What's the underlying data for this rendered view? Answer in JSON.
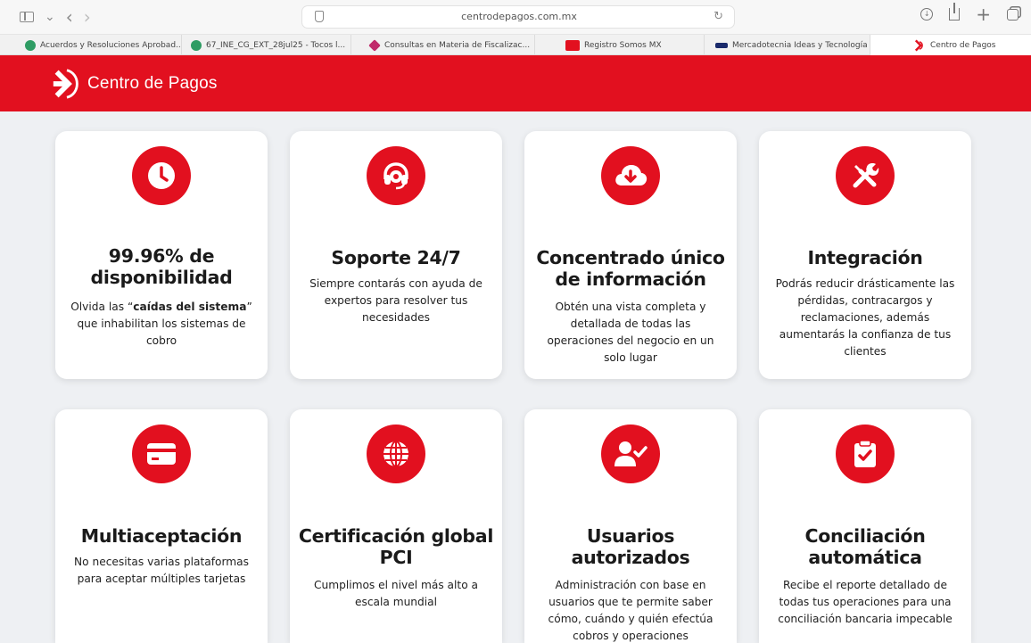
{
  "browser": {
    "url": "centrodepagos.com.mx",
    "back": "‹",
    "forward": "›",
    "new_tab": "+"
  },
  "bookmarks": [
    {
      "label": "Acuerdos y Resoluciones Aprobad...",
      "color": "#2e9c63"
    },
    {
      "label": "67_INE_CG_EXT_28jul25 - Tocos l...",
      "color": "#2e9c63"
    },
    {
      "label": "Consultas en Materia de Fiscalizac...",
      "color": "#c02a6b"
    },
    {
      "label": "Registro Somos MX",
      "color": "#e2101f"
    },
    {
      "label": "Mercadotecnia Ideas y Tecnología",
      "color": "#1a2a6b"
    },
    {
      "label": "Centro de Pagos",
      "color": "#e2101f"
    }
  ],
  "site": {
    "logo_text": "Centro de Pagos",
    "brand_color": "#e2101f"
  },
  "cards": [
    {
      "title": "99.96% de disponibilidad",
      "desc_pre": "Olvida las “",
      "desc_bold": "caídas del sistema",
      "desc_post": "” que inhabilitan los sistemas de cobro",
      "icon": "clock-icon"
    },
    {
      "title": "Soporte 24/7",
      "desc": "Siempre contarás con ayuda de expertos para resolver tus necesidades",
      "icon": "headset-icon"
    },
    {
      "title": "Concentrado único de información",
      "desc": "Obtén una vista completa y detallada de todas las operaciones del negocio en un solo lugar",
      "icon": "cloud-download-icon"
    },
    {
      "title": "Integración",
      "desc": "Podrás reducir drásticamente las pérdidas, contracargos y reclamaciones, además aumentarás la confianza de tus clientes",
      "icon": "tools-icon"
    },
    {
      "title": "Multiaceptación",
      "desc": "No necesitas varias plataformas para aceptar múltiples tarjetas",
      "icon": "credit-card-icon"
    },
    {
      "title": "Certificación global PCI",
      "desc": "Cumplimos el nivel más alto a escala mundial",
      "icon": "globe-icon"
    },
    {
      "title": "Usuarios autorizados",
      "desc": "Administración con base en usuarios que te permite saber cómo, cuándo y quién efectúa cobros y operaciones",
      "icon": "user-check-icon"
    },
    {
      "title": "Conciliación automática",
      "desc": "Recibe el reporte detallado de todas tus operaciones para una conciliación bancaria impecable",
      "icon": "clipboard-check-icon"
    }
  ]
}
